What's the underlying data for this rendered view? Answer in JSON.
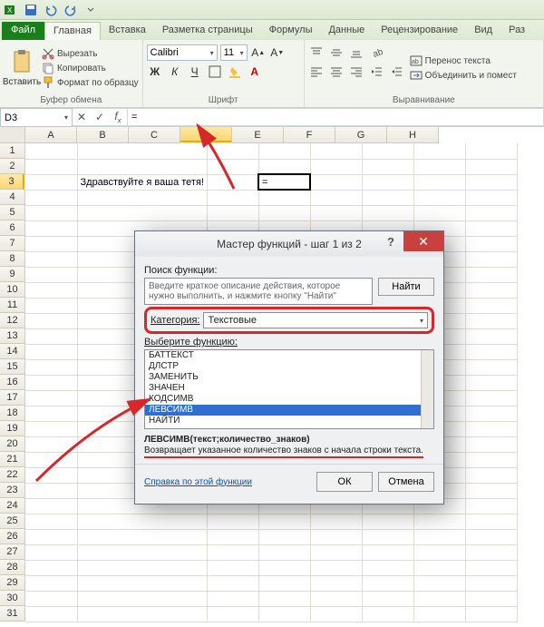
{
  "qat": {
    "icons": [
      "save-icon",
      "undo-icon",
      "redo-icon",
      "print-icon"
    ]
  },
  "tabs": {
    "file": "Файл",
    "items": [
      "Главная",
      "Вставка",
      "Разметка страницы",
      "Формулы",
      "Данные",
      "Рецензирование",
      "Вид",
      "Раз"
    ],
    "active": 0
  },
  "ribbon": {
    "clipboard": {
      "paste": "Вставить",
      "cut": "Вырезать",
      "copy": "Копировать",
      "format": "Формат по образцу",
      "title": "Буфер обмена"
    },
    "font": {
      "name": "Calibri",
      "size": "11",
      "title": "Шрифт"
    },
    "align": {
      "wrap": "Перенос текста",
      "merge": "Объединить и помест",
      "title": "Выравнивание"
    }
  },
  "namebox": "D3",
  "formula": "=",
  "columns": [
    "A",
    "B",
    "C",
    "D",
    "E",
    "F",
    "G",
    "H"
  ],
  "active_col_index": 3,
  "rows": 31,
  "active_row": 3,
  "cell_text": {
    "b3": "Здравствуйте я ваша тетя!",
    "d3": "="
  },
  "dialog": {
    "title": "Мастер функций - шаг 1 из 2",
    "search_label": "Поиск функции:",
    "search_placeholder": "Введите краткое описание действия, которое нужно выполнить, и нажмите кнопку \"Найти\"",
    "find": "Найти",
    "category_label": "Категория:",
    "category_value": "Текстовые",
    "select_label": "Выберите функцию:",
    "functions": [
      "БАТТЕКСТ",
      "ДЛСТР",
      "ЗАМЕНИТЬ",
      "ЗНАЧЕН",
      "КОДСИМВ",
      "ЛЕВСИМВ",
      "НАЙТИ"
    ],
    "selected_index": 5,
    "signature": "ЛЕВСИМВ(текст;количество_знаков)",
    "description": "Возвращает указанное количество знаков с начала строки текста.",
    "help": "Справка по этой функции",
    "ok": "ОК",
    "cancel": "Отмена"
  }
}
